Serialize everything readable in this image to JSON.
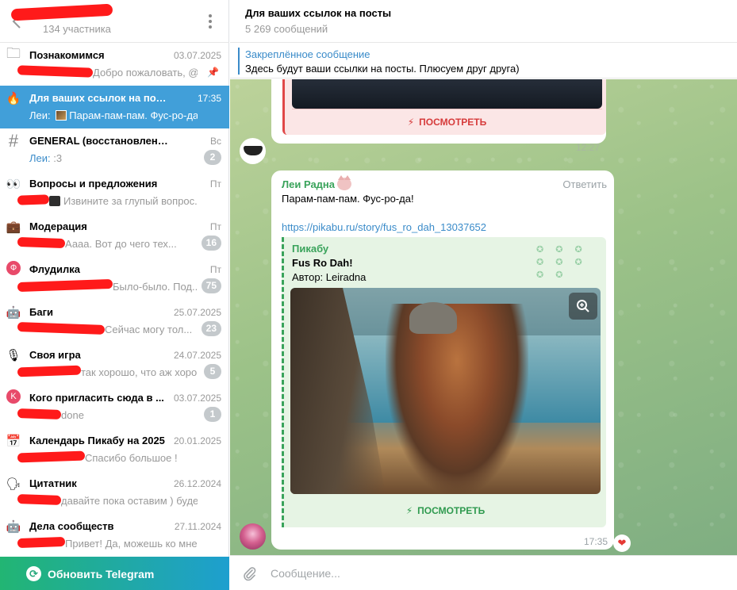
{
  "left": {
    "header": {
      "members": "134 участника"
    },
    "chats": [
      {
        "icon": "folder-icon",
        "glyph": "🗀",
        "name": "Познакомимся",
        "date": "03.07.2025",
        "preview": "Добро пожаловать, @an",
        "pinned": true,
        "badge": ""
      },
      {
        "icon": "fire-icon",
        "glyph": "🔥",
        "name": "Для ваших ссылок на посты",
        "date": "17:35",
        "sender": "Леи:",
        "preview": "Парам-пам-пам. Фус-ро-да!",
        "active": true,
        "badge": ""
      },
      {
        "icon": "hash-icon",
        "glyph": "#",
        "name": "GENERAL (восстановленный)",
        "date": "Вс",
        "sender": "Леи:",
        "preview": ":3",
        "badge": "2"
      },
      {
        "icon": "eyes-icon",
        "glyph": "👀",
        "name": "Вопросы и предложения",
        "date": "Пт",
        "preview": "Извините за глупый вопрос...",
        "badge": ""
      },
      {
        "icon": "briefcase-icon",
        "glyph": "💼",
        "name": "Модерация",
        "date": "Пт",
        "preview": "Аааа. Вот до чего тех...",
        "badge": "16"
      },
      {
        "icon": "flood-icon",
        "glyph": "Ф",
        "name": "Флудилка",
        "date": "Пт",
        "preview": "Было-было. Под...",
        "badge": "75"
      },
      {
        "icon": "robot-icon",
        "glyph": "🤖",
        "name": "Баги",
        "date": "25.07.2025",
        "preview": "Сейчас могу тол...",
        "badge": "23"
      },
      {
        "icon": "microphone-icon",
        "glyph": "🎙",
        "name": "Своя игра",
        "date": "24.07.2025",
        "preview": "так хорошо, что аж хорошо)",
        "badge": "5"
      },
      {
        "icon": "k-circle-icon",
        "glyph": "K",
        "name": "Кого пригласить сюда в ...",
        "date": "03.07.2025",
        "preview": "done",
        "badge": "1"
      },
      {
        "icon": "calendar-icon",
        "glyph": "📅",
        "name": "Календарь Пикабу на 2025",
        "date": "20.01.2025",
        "preview": "Спасибо большое !",
        "badge": ""
      },
      {
        "icon": "speech-icon",
        "glyph": "🗣",
        "name": "Цитатник",
        "date": "26.12.2024",
        "preview": "давайте пока оставим ) будет ...",
        "badge": ""
      },
      {
        "icon": "robot-icon",
        "glyph": "🤖",
        "name": "Дела сообществ",
        "date": "27.11.2024",
        "preview": "Привет! Да, можешь ко мне ...",
        "badge": ""
      }
    ],
    "update_label": "Обновить Telegram"
  },
  "header": {
    "title": "Для ваших ссылок на посты",
    "subtitle": "5 269 сообщений"
  },
  "pinned": {
    "title": "Закреплённое сообщение",
    "text": "Здесь будут ваши ссылки на посты. Плюсуем друг друга)"
  },
  "old_message": {
    "button_label": "ПОСМОТРЕТЬ",
    "time": "12:27"
  },
  "message": {
    "sender": "Леи Радна",
    "reply_label": "Ответить",
    "text": "Парам-пам-пам. Фус-ро-да!",
    "url": "https://pikabu.ru/story/fus_ro_dah_13037652",
    "preview": {
      "site": "Пикабу",
      "title": "Fus Ro Dah!",
      "description": "Автор: Leiradna",
      "button_label": "ПОСМОТРЕТЬ"
    },
    "time": "17:35",
    "reaction": "❤"
  },
  "composer": {
    "placeholder": "Сообщение..."
  },
  "colors": {
    "accent": "#419fd9",
    "sender_green": "#3aa35b",
    "link_blue": "#3a8bc9",
    "alert_red": "#d63b3b"
  }
}
